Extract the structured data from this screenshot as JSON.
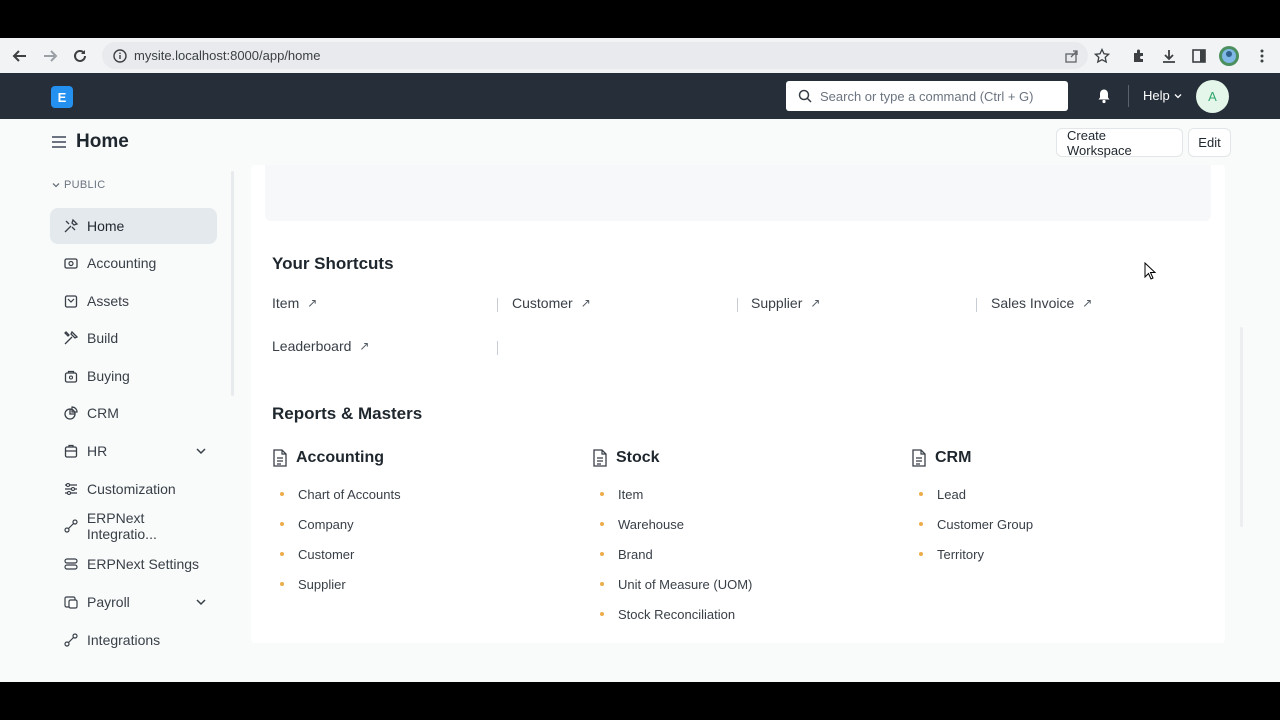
{
  "browser": {
    "url": "mysite.localhost:8000/app/home"
  },
  "navbar": {
    "logo_letter": "E",
    "search_placeholder": "Search or type a command (Ctrl + G)",
    "help_label": "Help",
    "avatar_initial": "A"
  },
  "page": {
    "title": "Home",
    "create_workspace_label": "Create Workspace",
    "edit_label": "Edit"
  },
  "sidebar": {
    "section_label": "PUBLIC",
    "items": [
      {
        "label": "Home",
        "icon": "tools-icon",
        "active": true
      },
      {
        "label": "Accounting",
        "icon": "accounting-icon"
      },
      {
        "label": "Assets",
        "icon": "assets-icon"
      },
      {
        "label": "Build",
        "icon": "build-icon"
      },
      {
        "label": "Buying",
        "icon": "buying-icon"
      },
      {
        "label": "CRM",
        "icon": "crm-icon"
      },
      {
        "label": "HR",
        "icon": "hr-icon",
        "expandable": true
      },
      {
        "label": "Customization",
        "icon": "customization-icon"
      },
      {
        "label": "ERPNext Integratio...",
        "icon": "integration-icon"
      },
      {
        "label": "ERPNext Settings",
        "icon": "settings-icon"
      },
      {
        "label": "Payroll",
        "icon": "payroll-icon",
        "expandable": true
      },
      {
        "label": "Integrations",
        "icon": "integrations-icon"
      }
    ]
  },
  "shortcuts": {
    "title": "Your Shortcuts",
    "items": [
      "Item",
      "Customer",
      "Supplier",
      "Sales Invoice",
      "Leaderboard"
    ],
    "arrow_glyph": "↗"
  },
  "reports": {
    "title": "Reports & Masters",
    "columns": [
      {
        "heading": "Accounting",
        "items": [
          "Chart of Accounts",
          "Company",
          "Customer",
          "Supplier"
        ]
      },
      {
        "heading": "Stock",
        "items": [
          "Item",
          "Warehouse",
          "Brand",
          "Unit of Measure (UOM)",
          "Stock Reconciliation"
        ]
      },
      {
        "heading": "CRM",
        "items": [
          "Lead",
          "Customer Group",
          "Territory"
        ]
      }
    ]
  },
  "colors": {
    "navbar_bg": "#262f39",
    "accent": "#2490ef",
    "bullet": "#ecad4b"
  }
}
